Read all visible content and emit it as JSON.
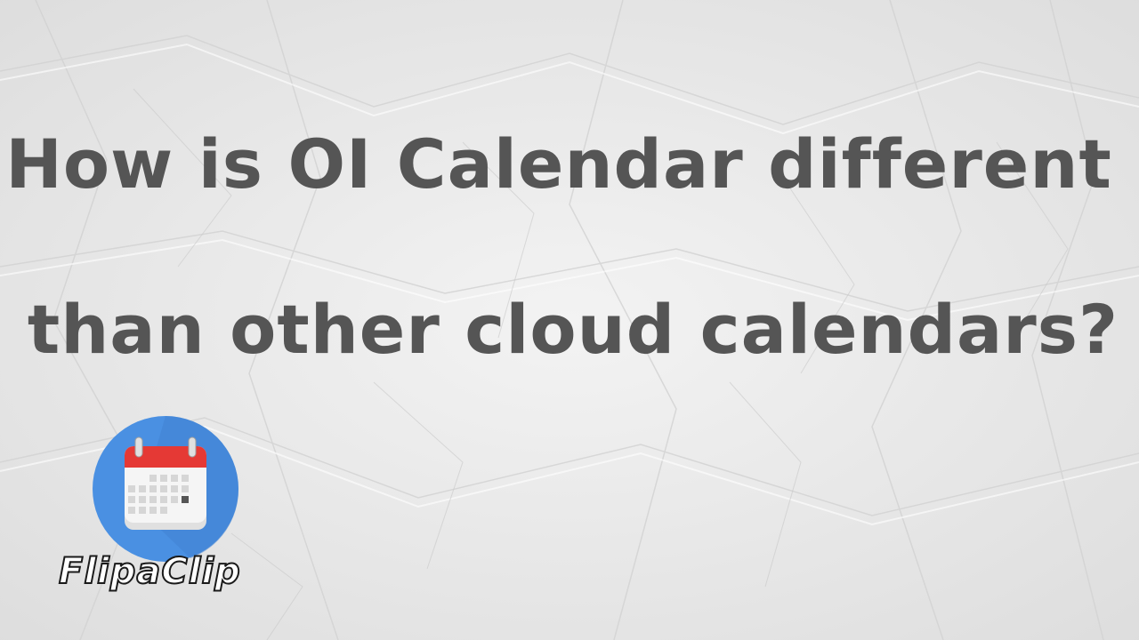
{
  "headline": {
    "line1": "How is OI Calendar different",
    "line2": "than other cloud calendars?"
  },
  "watermark": {
    "icon": "calendar-icon",
    "text": "FlipaClip"
  },
  "colors": {
    "background": "#ececec",
    "text": "#555555",
    "logo_circle": "#4a90e2",
    "calendar_header": "#e53935"
  }
}
